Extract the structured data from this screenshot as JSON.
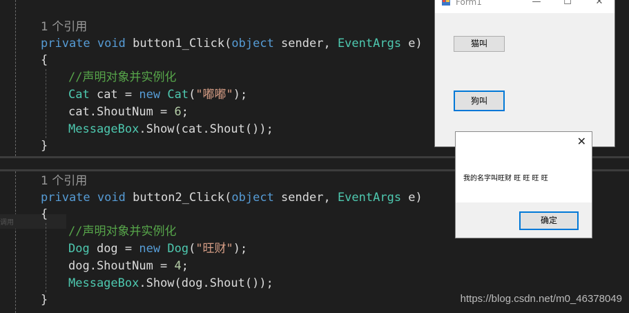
{
  "editor": {
    "block1": {
      "refs": "1 个引用",
      "sig_kw": "private void",
      "sig_name": "button1_Click",
      "sig_open": "(",
      "sig_obj": "object",
      "sig_sender": " sender, ",
      "sig_type": "EventArgs",
      "sig_end": " e)",
      "brace_open": "{",
      "comment": "//声明对象并实例化",
      "l1_type": "Cat",
      "l1_var": " cat = ",
      "l1_new": "new",
      "l1_sp": " ",
      "l1_type2": "Cat",
      "l1_paren": "(",
      "l1_str": "\"嘟嘟\"",
      "l1_end": ");",
      "l2_pre": "cat.ShoutNum = ",
      "l2_num": "6",
      "l2_end": ";",
      "l3_type": "MessageBox",
      "l3_rest": ".Show(cat.Shout());",
      "brace_close": "}"
    },
    "block2": {
      "refs": "1 个引用",
      "sig_kw": "private void",
      "sig_name": "button2_Click",
      "sig_open": "(",
      "sig_obj": "object",
      "sig_sender": " sender, ",
      "sig_type": "EventArgs",
      "sig_end": " e)",
      "brace_open": "{",
      "comment": "//声明对象并实例化",
      "l1_type": "Dog",
      "l1_var": " dog = ",
      "l1_new": "new",
      "l1_sp": " ",
      "l1_type2": "Dog",
      "l1_paren": "(",
      "l1_str": "\"旺财\"",
      "l1_end": ");",
      "l2_pre": "dog.ShoutNum = ",
      "l2_num": "4",
      "l2_end": ";",
      "l3_type": "MessageBox",
      "l3_rest": ".Show(dog.Shout());",
      "brace_close": "}"
    },
    "sel_label": "调用"
  },
  "form1": {
    "title": "Form1",
    "minimize": "—",
    "maximize": "☐",
    "close": "✕",
    "cat_button": "猫叫",
    "dog_button": "狗叫"
  },
  "messagebox": {
    "close": "✕",
    "text": "我的名字叫旺财 旺 旺 旺 旺",
    "ok_button": "确定"
  },
  "watermark": "https://blog.csdn.net/m0_46378049",
  "colors": {
    "keyword": "#569cd6",
    "type": "#4ec9b0",
    "comment": "#57a64a",
    "string": "#d69d85",
    "number": "#b5cea8",
    "accent": "#0078d7"
  }
}
